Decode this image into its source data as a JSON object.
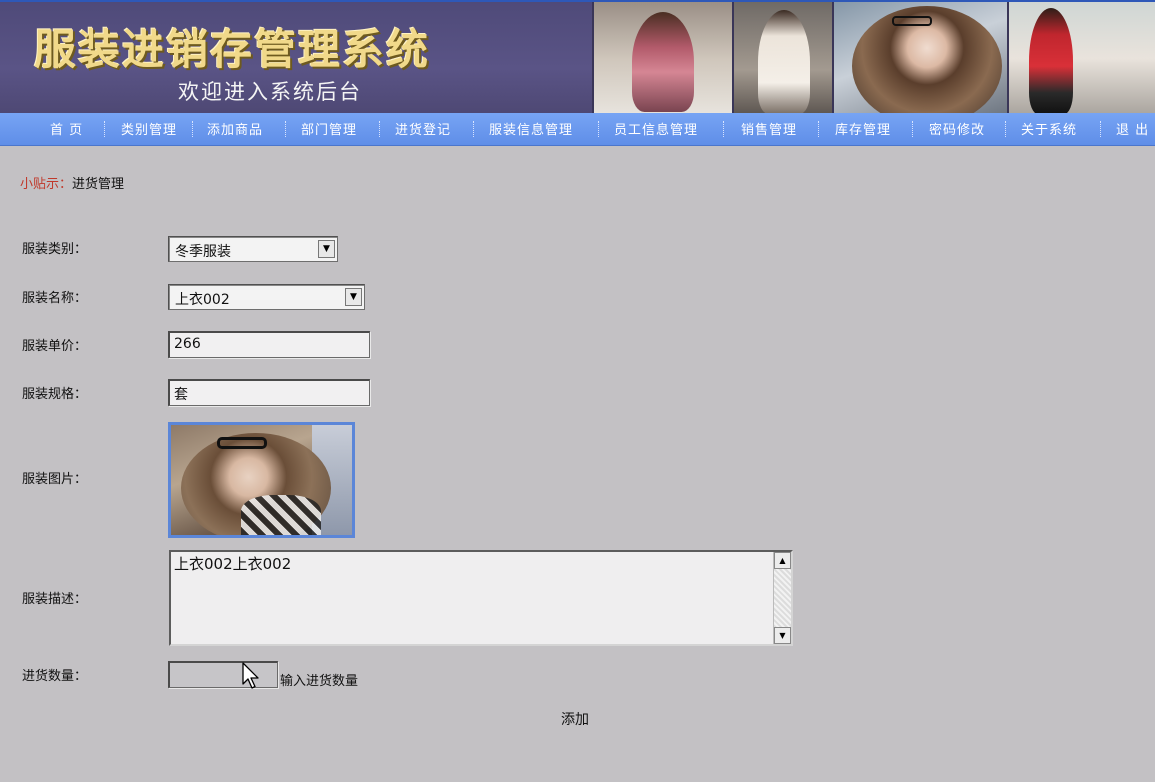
{
  "header": {
    "title": "服装进销存管理系统",
    "subtitle": "欢迎进入系统后台"
  },
  "nav": {
    "items": [
      {
        "label": "首 页",
        "name": "nav-item-home"
      },
      {
        "label": "类别管理",
        "name": "nav-item-category"
      },
      {
        "label": "添加商品",
        "name": "nav-item-add-product"
      },
      {
        "label": "部门管理",
        "name": "nav-item-department"
      },
      {
        "label": "进货登记",
        "name": "nav-item-purchase"
      },
      {
        "label": "服装信息管理",
        "name": "nav-item-clothing-info"
      },
      {
        "label": "员工信息管理",
        "name": "nav-item-staff-info"
      },
      {
        "label": "销售管理",
        "name": "nav-item-sales"
      },
      {
        "label": "库存管理",
        "name": "nav-item-inventory"
      },
      {
        "label": "密码修改",
        "name": "nav-item-password"
      },
      {
        "label": "关于系统",
        "name": "nav-item-about"
      },
      {
        "label": "退 出",
        "name": "nav-item-logout"
      }
    ]
  },
  "tip": {
    "label": "小贴示：",
    "text": "进货管理"
  },
  "form": {
    "category": {
      "label": "服装类别：",
      "value": "冬季服装"
    },
    "name": {
      "label": "服装名称：",
      "value": "上衣002"
    },
    "price": {
      "label": "服装单价：",
      "value": "266"
    },
    "spec": {
      "label": "服装规格：",
      "value": "套"
    },
    "image": {
      "label": "服装图片："
    },
    "description": {
      "label": "服装描述：",
      "value": "上衣002上衣002"
    },
    "quantity": {
      "label": "进货数量：",
      "value": "",
      "hint": "输入进货数量"
    },
    "submit_label": "添加"
  },
  "colors": {
    "nav_bg": "#6a98ee",
    "page_bg": "#c3c1c4",
    "tip_label": "#c0392b",
    "banner_title": "#f1d98a"
  }
}
